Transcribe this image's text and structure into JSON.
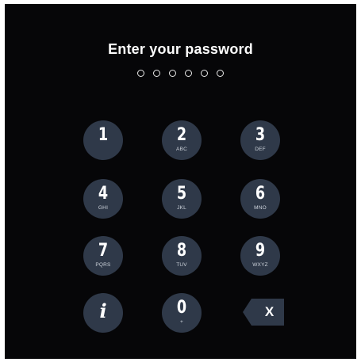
{
  "prompt": {
    "title": "Enter your password",
    "pin_length": 6,
    "entered_count": 0
  },
  "keypad": {
    "keys": [
      {
        "digit": "1",
        "letters": ""
      },
      {
        "digit": "2",
        "letters": "ABC"
      },
      {
        "digit": "3",
        "letters": "DEF"
      },
      {
        "digit": "4",
        "letters": "GHI"
      },
      {
        "digit": "5",
        "letters": "JKL"
      },
      {
        "digit": "6",
        "letters": "MNO"
      },
      {
        "digit": "7",
        "letters": "PQRS"
      },
      {
        "digit": "8",
        "letters": "TUV"
      },
      {
        "digit": "9",
        "letters": "WXYZ"
      },
      {
        "digit": "0",
        "letters": "+"
      }
    ],
    "info_label": "i",
    "backspace_label": "X"
  },
  "colors": {
    "background": "#060608",
    "key": "#2f3949",
    "text": "#ffffff",
    "dot_outline": "#e8e8e8"
  },
  "icons": {
    "info": "info-icon",
    "backspace": "backspace-icon"
  }
}
